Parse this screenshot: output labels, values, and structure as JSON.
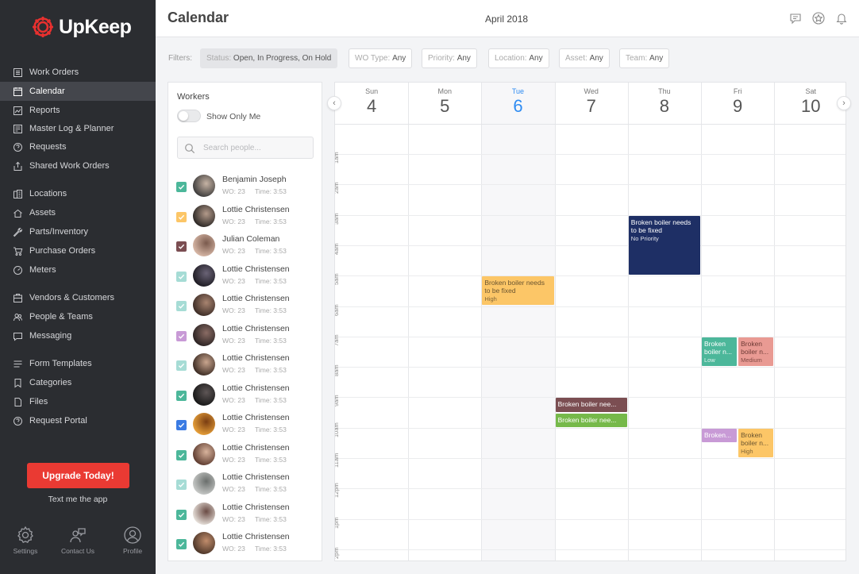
{
  "brand": {
    "name": "UpKeep",
    "accent": "#e9302f"
  },
  "nav": [
    {
      "label": "Work Orders",
      "icon": "list-icon",
      "active": false
    },
    {
      "label": "Calendar",
      "icon": "calendar-icon",
      "active": true
    },
    {
      "label": "Reports",
      "icon": "chart-icon",
      "active": false
    },
    {
      "label": "Master Log & Planner",
      "icon": "log-icon",
      "active": false
    },
    {
      "label": "Requests",
      "icon": "question-icon",
      "active": false
    },
    {
      "label": "Shared Work Orders",
      "icon": "share-icon",
      "active": false
    },
    {
      "label": "Locations",
      "icon": "location-icon",
      "active": false
    },
    {
      "label": "Assets",
      "icon": "assets-icon",
      "active": false
    },
    {
      "label": "Parts/Inventory",
      "icon": "wrench-icon",
      "active": false
    },
    {
      "label": "Purchase Orders",
      "icon": "cart-icon",
      "active": false
    },
    {
      "label": "Meters",
      "icon": "gauge-icon",
      "active": false
    },
    {
      "label": "Vendors & Customers",
      "icon": "vendors-icon",
      "active": false
    },
    {
      "label": "People & Teams",
      "icon": "people-icon",
      "active": false
    },
    {
      "label": "Messaging",
      "icon": "chat-icon",
      "active": false
    },
    {
      "label": "Form Templates",
      "icon": "form-icon",
      "active": false
    },
    {
      "label": "Categories",
      "icon": "bookmark-icon",
      "active": false
    },
    {
      "label": "Files",
      "icon": "file-icon",
      "active": false
    },
    {
      "label": "Request Portal",
      "icon": "portal-icon",
      "active": false
    }
  ],
  "upgrade_label": "Upgrade Today!",
  "text_app_label": "Text me the app",
  "footer": {
    "settings": "Settings",
    "contact": "Contact Us",
    "profile": "Profile"
  },
  "header": {
    "title": "Calendar",
    "month": "April 2018"
  },
  "filters": {
    "label": "Filters:",
    "status": {
      "key": "Status:",
      "value": "Open, In Progress, On Hold"
    },
    "wo_type": {
      "key": "WO Type:",
      "value": "Any"
    },
    "priority": {
      "key": "Priority:",
      "value": "Any"
    },
    "location": {
      "key": "Location:",
      "value": "Any"
    },
    "asset": {
      "key": "Asset:",
      "value": "Any"
    },
    "team": {
      "key": "Team:",
      "value": "Any"
    }
  },
  "workers_panel": {
    "title": "Workers",
    "show_only_me": "Show Only Me",
    "search_placeholder": "Search people...",
    "workers": [
      {
        "name": "Benjamin Joseph",
        "wo": "WO: 23",
        "time": "Time: 3:53",
        "color": "#4cb79a",
        "checked": true
      },
      {
        "name": "Lottie Christensen",
        "wo": "WO: 23",
        "time": "Time: 3:53",
        "color": "#fcc667",
        "checked": true
      },
      {
        "name": "Julian Coleman",
        "wo": "WO: 23",
        "time": "Time: 3:53",
        "color": "#7b4e52",
        "checked": true
      },
      {
        "name": "Lottie Christensen",
        "wo": "WO: 23",
        "time": "Time: 3:53",
        "color": "#a6dcd5",
        "checked": true
      },
      {
        "name": "Lottie Christensen",
        "wo": "WO: 23",
        "time": "Time: 3:53",
        "color": "#a6dcd5",
        "checked": true
      },
      {
        "name": "Lottie Christensen",
        "wo": "WO: 23",
        "time": "Time: 3:53",
        "color": "#c89ad6",
        "checked": true
      },
      {
        "name": "Lottie Christensen",
        "wo": "WO: 23",
        "time": "Time: 3:53",
        "color": "#a6dcd5",
        "checked": true
      },
      {
        "name": "Lottie Christensen",
        "wo": "WO: 23",
        "time": "Time: 3:53",
        "color": "#4cb79a",
        "checked": true
      },
      {
        "name": "Lottie Christensen",
        "wo": "WO: 23",
        "time": "Time: 3:53",
        "color": "#3a7be3",
        "checked": true
      },
      {
        "name": "Lottie Christensen",
        "wo": "WO: 23",
        "time": "Time: 3:53",
        "color": "#4cb79a",
        "checked": true
      },
      {
        "name": "Lottie Christensen",
        "wo": "WO: 23",
        "time": "Time: 3:53",
        "color": "#a6dcd5",
        "checked": true
      },
      {
        "name": "Lottie Christensen",
        "wo": "WO: 23",
        "time": "Time: 3:53",
        "color": "#4cb79a",
        "checked": true
      },
      {
        "name": "Lottie Christensen",
        "wo": "WO: 23",
        "time": "Time: 3:53",
        "color": "#4cb79a",
        "checked": true
      }
    ]
  },
  "calendar": {
    "days": [
      {
        "name": "Sun",
        "date": "4",
        "today": false
      },
      {
        "name": "Mon",
        "date": "5",
        "today": false
      },
      {
        "name": "Tue",
        "date": "6",
        "today": true
      },
      {
        "name": "Wed",
        "date": "7",
        "today": false
      },
      {
        "name": "Thu",
        "date": "8",
        "today": false
      },
      {
        "name": "Fri",
        "date": "9",
        "today": false
      },
      {
        "name": "Sat",
        "date": "10",
        "today": false
      }
    ],
    "hours": [
      "1am",
      "2am",
      "3am",
      "4am",
      "5am",
      "6am",
      "7am",
      "8am",
      "9am",
      "10am",
      "11am",
      "12pm",
      "1pm",
      "2pm"
    ],
    "events": [
      {
        "day": 4,
        "start": 3,
        "end": 5,
        "lane": 0,
        "lanes": 1,
        "title": "Broken boiler needs to be fixed",
        "priority": "No Priority",
        "color": "#1e2f65",
        "text": "#ffffff"
      },
      {
        "day": 2,
        "start": 5,
        "end": 6,
        "lane": 0,
        "lanes": 1,
        "title": "Broken boiler needs to be fixed",
        "priority": "High",
        "color": "#fcc667",
        "text": "#6b5530"
      },
      {
        "day": 5,
        "start": 7,
        "end": 8,
        "lane": 0,
        "lanes": 2,
        "title": "Broken boiler n...",
        "priority": "Low",
        "color": "#4cb79a",
        "text": "#ffffff"
      },
      {
        "day": 5,
        "start": 7,
        "end": 8,
        "lane": 1,
        "lanes": 2,
        "title": "Broken boiler n...",
        "priority": "Medium",
        "color": "#e99a93",
        "text": "#6e3b36"
      },
      {
        "day": 3,
        "start": 9,
        "end": 9.5,
        "lane": 0,
        "lanes": 1,
        "title": "Broken boiler nee...",
        "priority": "",
        "color": "#7b4e52",
        "text": "#ffffff"
      },
      {
        "day": 3,
        "start": 9.5,
        "end": 10,
        "lane": 0,
        "lanes": 1,
        "title": "Broken boiler nee...",
        "priority": "",
        "color": "#76b94a",
        "text": "#ffffff"
      },
      {
        "day": 5,
        "start": 10,
        "end": 10.5,
        "lane": 0,
        "lanes": 2,
        "title": "Broken...",
        "priority": "",
        "color": "#c89ad6",
        "text": "#ffffff"
      },
      {
        "day": 5,
        "start": 10,
        "end": 11,
        "lane": 1,
        "lanes": 2,
        "title": "Broken boiler n...",
        "priority": "High",
        "color": "#fcc667",
        "text": "#6b5530"
      }
    ]
  }
}
